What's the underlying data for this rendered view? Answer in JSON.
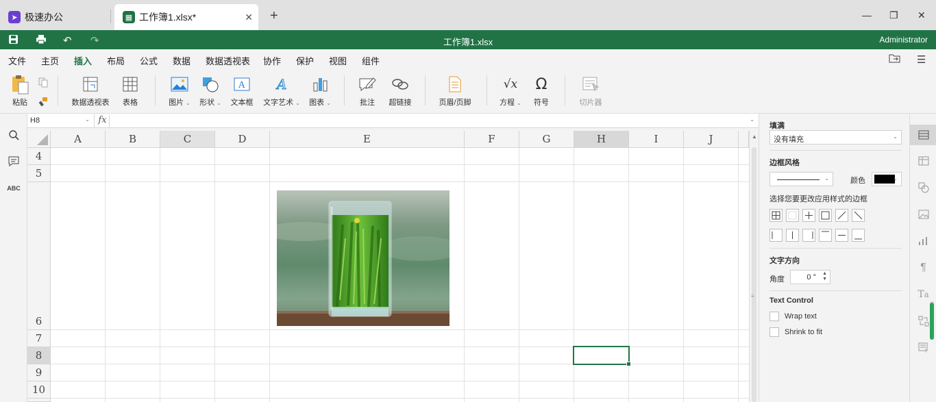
{
  "tabs": [
    {
      "label": "极速办公",
      "icon": "rocket-icon"
    },
    {
      "label": "工作簿1.xlsx*",
      "icon": "spreadsheet-icon"
    }
  ],
  "titlebar": {
    "document_name": "工作簿1.xlsx",
    "user": "Administrator"
  },
  "menu": [
    "文件",
    "主页",
    "插入",
    "布局",
    "公式",
    "数据",
    "数据透视表",
    "协作",
    "保护",
    "视图",
    "组件"
  ],
  "active_menu": "插入",
  "ribbon": {
    "paste": "粘贴",
    "pivot_table": "数据透视表",
    "table": "表格",
    "picture": "图片",
    "shape": "形状",
    "textbox": "文本框",
    "wordart": "文字艺术",
    "chart": "图表",
    "comment": "批注",
    "hyperlink": "超链接",
    "header_footer": "页眉/页脚",
    "equation": "方程",
    "symbol": "符号",
    "slicer": "切片器"
  },
  "formula_bar": {
    "cell_ref": "H8",
    "fx": "fx",
    "formula": ""
  },
  "grid": {
    "columns": [
      "A",
      "B",
      "C",
      "D",
      "E",
      "F",
      "G",
      "H",
      "I",
      "J"
    ],
    "rows": [
      "4",
      "5",
      "6",
      "7",
      "8",
      "9",
      "10"
    ],
    "selected_cell": "H8",
    "selected_column": "H",
    "selected_row": "8"
  },
  "panel": {
    "fill_title": "填满",
    "fill_value": "没有填充",
    "border_style_title": "边框风格",
    "color_label": "颜色",
    "border_color": "#000000",
    "border_hint": "选择您要更改应用样式的边框",
    "text_direction_title": "文字方向",
    "angle_label": "角度",
    "angle_value": "0 °",
    "text_control_title": "Text Control",
    "wrap_text": "Wrap text",
    "shrink_to_fit": "Shrink to fit"
  },
  "colors": {
    "accent": "#217346",
    "tabbar": "#e1e1e1",
    "sheet_selected_header": "#d8d8d8"
  }
}
